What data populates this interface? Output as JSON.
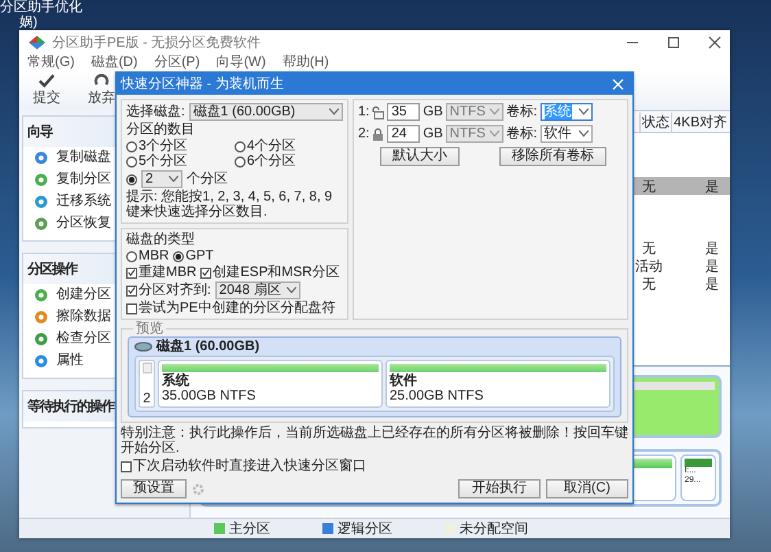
{
  "desktop": {
    "icon_label_lines": [
      "分区助手优化",
      "娲)"
    ]
  },
  "window": {
    "title": "分区助手PE版 - 无损分区免费软件"
  },
  "menu": [
    "常规(G)",
    "磁盘(D)",
    "分区(P)",
    "向导(W)",
    "帮助(H)"
  ],
  "toolbar": [
    {
      "label": "提交",
      "kind": "commit"
    },
    {
      "label": "放弃",
      "kind": "discard"
    }
  ],
  "sidebar": [
    {
      "title": "向导",
      "items": [
        {
          "label": "复制磁盘",
          "kind": "disk"
        },
        {
          "label": "复制分区",
          "kind": "partition"
        },
        {
          "label": "迁移系统",
          "kind": "migrate"
        },
        {
          "label": "分区恢复",
          "kind": "recover"
        }
      ]
    },
    {
      "title": "分区操作",
      "items": [
        {
          "label": "创建分区",
          "kind": "create"
        },
        {
          "label": "擦除数据",
          "kind": "wipe"
        },
        {
          "label": "检查分区",
          "kind": "check"
        },
        {
          "label": "属性",
          "kind": "info"
        }
      ]
    },
    {
      "title": "等待执行的操作"
    }
  ],
  "table": {
    "columns": [
      "状态",
      "4KB对齐"
    ],
    "groups": [
      {
        "rows": [
          {
            "cells": [
              "无",
              "是"
            ],
            "selected": true
          }
        ]
      },
      {
        "rows": [
          {
            "cells": [
              "无",
              "是"
            ],
            "selected": false
          },
          {
            "cells": [
              "活动",
              "是"
            ],
            "selected": false
          },
          {
            "cells": [
              "无",
              "是"
            ],
            "selected": false
          }
        ]
      }
    ]
  },
  "disk_map": {
    "small_partition": {
      "letter": "I:...",
      "size": "29..."
    }
  },
  "legend": [
    {
      "label": "主分区",
      "color": "#5cc85c"
    },
    {
      "label": "逻辑分区",
      "color": "#3a7fd8"
    },
    {
      "label": "未分配空间",
      "color": "#f0f0e0"
    }
  ],
  "dialog": {
    "title": "快速分区神器 - 为装机而生",
    "disk_select": {
      "label": "选择磁盘:",
      "value": "磁盘1 (60.00GB)"
    },
    "count": {
      "label": "分区的数目",
      "options": [
        {
          "label": "3个分区",
          "selected": false
        },
        {
          "label": "4个分区",
          "selected": false
        },
        {
          "label": "5个分区",
          "selected": false
        },
        {
          "label": "6个分区",
          "selected": false
        }
      ],
      "custom": {
        "selected": true,
        "value": "2",
        "suffix": "个分区"
      }
    },
    "hint": "提示: 您能按1, 2, 3, 4, 5, 6, 7, 8, 9键来快速选择分区数目.",
    "disk_type": {
      "label": "磁盘的类型",
      "options": [
        {
          "label": "MBR",
          "selected": false
        },
        {
          "label": "GPT",
          "selected": true
        }
      ]
    },
    "checks": [
      {
        "label": "重建MBR",
        "checked": true
      },
      {
        "label": "创建ESP和MSR分区",
        "checked": true
      }
    ],
    "align": {
      "label": "分区对齐到:",
      "checked": true,
      "value": "2048 扇区"
    },
    "assign_letter": {
      "label": "尝试为PE中创建的分区分配盘符",
      "checked": false
    },
    "partitions": [
      {
        "index": "1:",
        "locked": false,
        "size": "35",
        "unit": "GB",
        "fs": "NTFS",
        "label_caption": "卷标:",
        "label": "系统",
        "focused": true
      },
      {
        "index": "2:",
        "locked": true,
        "size": "24",
        "unit": "GB",
        "fs": "NTFS",
        "label_caption": "卷标:",
        "label": "软件",
        "focused": false
      }
    ],
    "default_size_button": "默认大小",
    "remove_labels_button": "移除所有卷标",
    "preview": {
      "title": "预览",
      "disk": "磁盘1 (60.00GB)",
      "checked": false,
      "number": "2",
      "partitions": [
        {
          "name": "系统",
          "detail": "35.00GB NTFS"
        },
        {
          "name": "软件",
          "detail": "25.00GB NTFS"
        }
      ]
    },
    "warning": "特别注意：执行此操作后，当前所选磁盘上已经存在的所有分区将被删除！按回车键开始分区.",
    "remember": {
      "label": "下次启动软件时直接进入快速分区窗口",
      "checked": false
    },
    "buttons": {
      "preset": "预设置",
      "start": "开始执行",
      "cancel": "取消(C)"
    }
  }
}
